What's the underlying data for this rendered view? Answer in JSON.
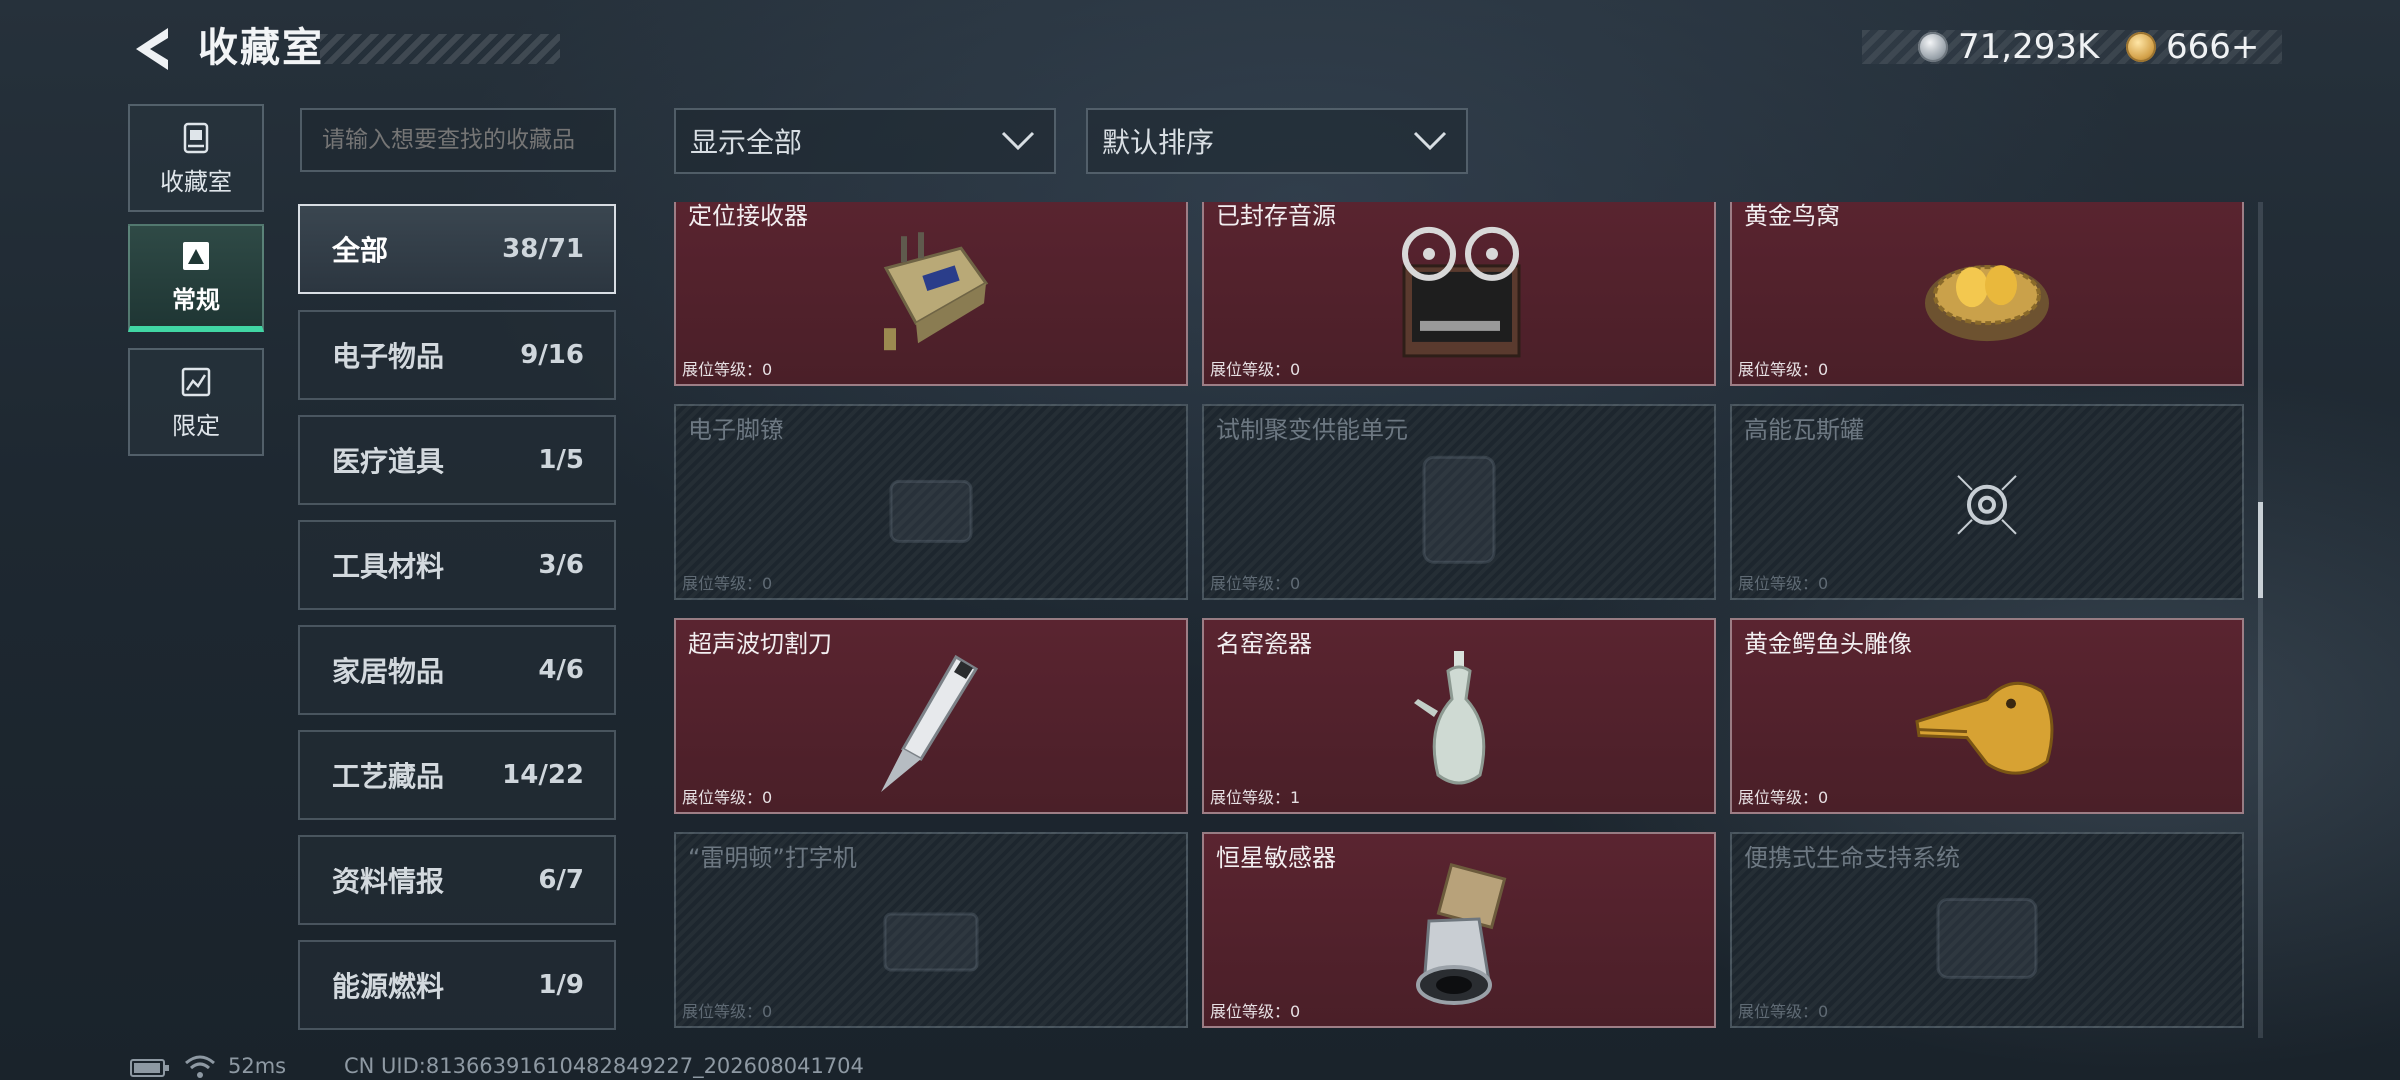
{
  "header": {
    "title": "收藏室",
    "currencies": [
      {
        "icon": "silver-coin-icon",
        "value": "71,293K"
      },
      {
        "icon": "gold-coin-icon",
        "value": "666+"
      }
    ]
  },
  "nav": [
    {
      "label": "收藏室",
      "icon": "collection-room-icon",
      "active": false
    },
    {
      "label": "常规",
      "icon": "regular-icon",
      "active": true
    },
    {
      "label": "限定",
      "icon": "limited-icon",
      "active": false
    }
  ],
  "search": {
    "placeholder": "请输入想要查找的收藏品"
  },
  "categories": [
    {
      "name": "全部",
      "count": "38/71",
      "active": true
    },
    {
      "name": "电子物品",
      "count": "9/16"
    },
    {
      "name": "医疗道具",
      "count": "1/5"
    },
    {
      "name": "工具材料",
      "count": "3/6"
    },
    {
      "name": "家居物品",
      "count": "4/6"
    },
    {
      "name": "工艺藏品",
      "count": "14/22"
    },
    {
      "name": "资料情报",
      "count": "6/7"
    },
    {
      "name": "能源燃料",
      "count": "1/9"
    }
  ],
  "filters": {
    "show": "显示全部",
    "sort": "默认排序"
  },
  "items": [
    {
      "name": "定位接收器",
      "level": "展位等级：0",
      "owned": true,
      "icon": "locator-receiver-icon"
    },
    {
      "name": "已封存音源",
      "level": "展位等级：0",
      "owned": true,
      "icon": "reel-tape-recorder-icon"
    },
    {
      "name": "黄金鸟窝",
      "level": "展位等级：0",
      "owned": true,
      "icon": "golden-nest-icon"
    },
    {
      "name": "电子脚镣",
      "level": "展位等级：0",
      "owned": false,
      "icon": "electronic-shackle-icon"
    },
    {
      "name": "试制聚变供能单元",
      "level": "展位等级：0",
      "owned": false,
      "icon": "fusion-power-unit-icon"
    },
    {
      "name": "高能瓦斯罐",
      "level": "展位等级：0",
      "owned": false,
      "icon": "gas-canister-icon"
    },
    {
      "name": "超声波切割刀",
      "level": "展位等级：0",
      "owned": true,
      "icon": "ultrasonic-cutter-icon"
    },
    {
      "name": "名窑瓷器",
      "level": "展位等级：1",
      "owned": true,
      "icon": "porcelain-vase-icon"
    },
    {
      "name": "黄金鳄鱼头雕像",
      "level": "展位等级：0",
      "owned": true,
      "icon": "golden-crocodile-icon"
    },
    {
      "name": "“雷明顿”打字机",
      "level": "展位等级：0",
      "owned": false,
      "icon": "typewriter-icon"
    },
    {
      "name": "恒星敏感器",
      "level": "展位等级：0",
      "owned": true,
      "icon": "star-sensor-icon"
    },
    {
      "name": "便携式生命支持系统",
      "level": "展位等级：0",
      "owned": false,
      "icon": "life-support-icon"
    }
  ],
  "status": {
    "latency": "52ms",
    "uid": "CN UID:81366391610482849227_202608041704"
  },
  "colors": {
    "accent": "#41d6a4",
    "owned_card": "#4f2029",
    "locked_card": "#1d262e"
  }
}
